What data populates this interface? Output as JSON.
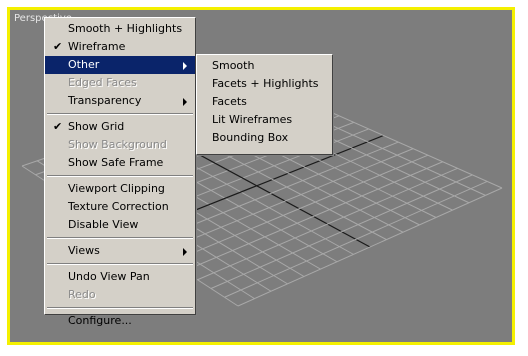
{
  "viewport": {
    "label": "Perspective",
    "border_color": "#f4f000",
    "background": "#7d7d7d"
  },
  "menu": {
    "items": [
      {
        "label": "Smooth + Highlights"
      },
      {
        "label": "Wireframe",
        "checked": true
      },
      {
        "label": "Other",
        "submenu": true,
        "highlighted": true
      },
      {
        "label": "Edged Faces",
        "disabled": true
      },
      {
        "label": "Transparency",
        "submenu": true
      },
      {
        "label": "Show Grid",
        "checked": true
      },
      {
        "label": "Show Background",
        "disabled": true
      },
      {
        "label": "Show Safe Frame"
      },
      {
        "label": "Viewport Clipping"
      },
      {
        "label": "Texture Correction"
      },
      {
        "label": "Disable View"
      },
      {
        "label": "Views",
        "submenu": true
      },
      {
        "label": "Undo View Pan"
      },
      {
        "label": "Redo",
        "disabled": true
      },
      {
        "label": "Configure..."
      }
    ]
  },
  "submenu": {
    "items": [
      {
        "label": "Smooth"
      },
      {
        "label": "Facets + Highlights"
      },
      {
        "label": "Facets"
      },
      {
        "label": "Lit Wireframes"
      },
      {
        "label": "Bounding Box"
      }
    ]
  },
  "icons": {
    "check": "checkmark-icon",
    "submenu_arrow": "submenu-arrow-icon"
  },
  "colors": {
    "menu_bg": "#d4d0c8",
    "highlight": "#0a246a",
    "disabled_text": "#8a8a8a"
  }
}
